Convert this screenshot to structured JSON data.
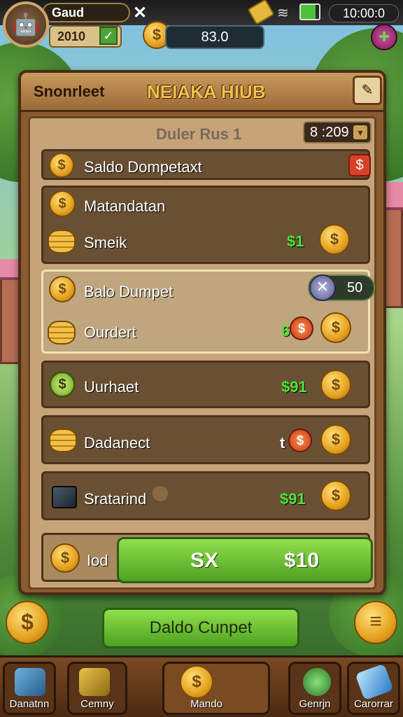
{
  "status": {
    "player_name": "Gaud",
    "clock": "10:00:0"
  },
  "currency": {
    "level": "2010",
    "balance": "83.0",
    "coin_symbol": "$",
    "plus": "+"
  },
  "board": {
    "tab": "Snonrleet",
    "title": "NEIAKA HIUB",
    "subtitle": "Duler Rus 1",
    "timer": "8 :209"
  },
  "rows": [
    {
      "label": "Saldo Dompetaxt",
      "badge": "$"
    },
    {
      "label": "Matandatan"
    },
    {
      "label": "Smeik",
      "value": "$1"
    },
    {
      "label": "Balo Dumpet",
      "value": "50"
    },
    {
      "label": "Ourdert",
      "value": "6",
      "coin": "$"
    },
    {
      "label": "Uurhaet",
      "value": "$91"
    },
    {
      "label": "Dadanect",
      "value": "t",
      "coin": "$"
    },
    {
      "label": "Sratarind",
      "value": "$91"
    }
  ],
  "bottom_row": {
    "label": "Iod",
    "btn_left": "SX",
    "btn_right": "$10"
  },
  "main_button": "Daldo Cunpet",
  "menu_icon": "≡",
  "nav": [
    {
      "label": "Danatnn"
    },
    {
      "label": "Cemny"
    },
    {
      "label": "Mando"
    },
    {
      "label": "Genrjn"
    },
    {
      "label": "Carorrar"
    }
  ],
  "colors": {
    "accent_gold": "#f2c24a",
    "positive_green": "#4ee43a",
    "wood": "#8a5a30"
  }
}
